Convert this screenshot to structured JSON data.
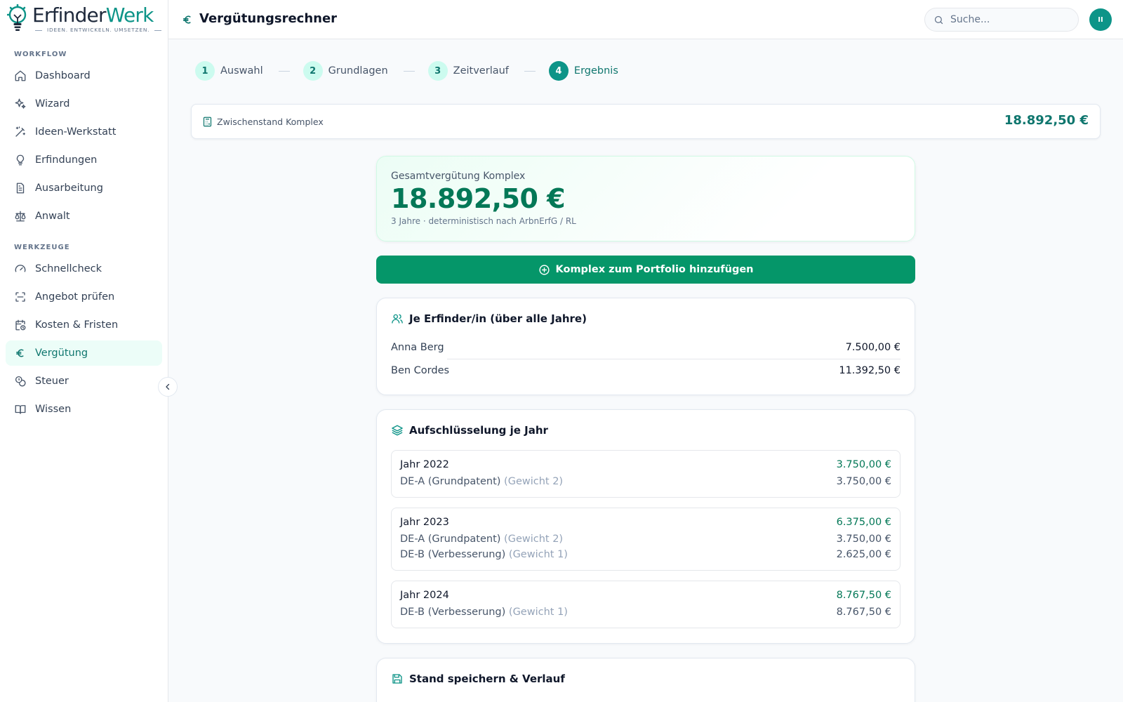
{
  "logo": {
    "word_dark": "Erfinder",
    "word_accent": "Werk",
    "tagline": "IDEEN. ENTWICKELN. UMSETZEN."
  },
  "sidebar": {
    "sections": [
      {
        "label": "WORKFLOW",
        "items": [
          {
            "label": "Dashboard",
            "icon": "home-icon"
          },
          {
            "label": "Wizard",
            "icon": "sparkles-icon"
          },
          {
            "label": "Ideen-Werkstatt",
            "icon": "magic-wand-icon"
          },
          {
            "label": "Erfindungen",
            "icon": "lightbulb-icon"
          },
          {
            "label": "Ausarbeitung",
            "icon": "document-icon"
          },
          {
            "label": "Anwalt",
            "icon": "scales-icon"
          }
        ]
      },
      {
        "label": "WERKZEUGE",
        "items": [
          {
            "label": "Schnellcheck",
            "icon": "gauge-icon"
          },
          {
            "label": "Angebot prüfen",
            "icon": "scan-icon"
          },
          {
            "label": "Kosten & Fristen",
            "icon": "calendar-clock-icon"
          },
          {
            "label": "Vergütung",
            "icon": "euro-icon",
            "active": true
          },
          {
            "label": "Steuer",
            "icon": "coins-icon"
          },
          {
            "label": "Wissen",
            "icon": "book-icon"
          }
        ]
      }
    ]
  },
  "header": {
    "title": "Vergütungsrechner",
    "search_placeholder": "Suche...",
    "avatar_initials": "II"
  },
  "stepper": [
    {
      "num": "1",
      "label": "Auswahl"
    },
    {
      "num": "2",
      "label": "Grundlagen"
    },
    {
      "num": "3",
      "label": "Zeitverlauf"
    },
    {
      "num": "4",
      "label": "Ergebnis",
      "active": true
    }
  ],
  "subtotal": {
    "label": "Zwischenstand Komplex",
    "value": "18.892,50 €"
  },
  "total": {
    "label": "Gesamtvergütung Komplex",
    "value": "18.892,50 €",
    "sub": "3 Jahre · deterministisch nach ArbnErfG / RL"
  },
  "add_button": {
    "label": "Komplex zum Portfolio hinzufügen"
  },
  "inventors": {
    "title": "Je Erfinder/in (über alle Jahre)",
    "rows": [
      {
        "name": "Anna Berg",
        "amount": "7.500,00 €"
      },
      {
        "name": "Ben Cordes",
        "amount": "11.392,50 €"
      }
    ]
  },
  "breakdown": {
    "title": "Aufschlüsselung je Jahr",
    "years": [
      {
        "year": "Jahr 2022",
        "total": "3.750,00 €",
        "items": [
          {
            "name": "DE-A (Grundpatent)",
            "weight": "(Gewicht 2)",
            "amount": "3.750,00 €"
          }
        ]
      },
      {
        "year": "Jahr 2023",
        "total": "6.375,00 €",
        "items": [
          {
            "name": "DE-A (Grundpatent)",
            "weight": "(Gewicht 2)",
            "amount": "3.750,00 €"
          },
          {
            "name": "DE-B (Verbesserung)",
            "weight": "(Gewicht 1)",
            "amount": "2.625,00 €"
          }
        ]
      },
      {
        "year": "Jahr 2024",
        "total": "8.767,50 €",
        "items": [
          {
            "name": "DE-B (Verbesserung)",
            "weight": "(Gewicht 1)",
            "amount": "8.767,50 €"
          }
        ]
      }
    ]
  },
  "save": {
    "title": "Stand speichern & Verlauf"
  },
  "colors": {
    "accent": "#0d9488",
    "accent_dark": "#0f766e",
    "money_green": "#047857",
    "button_green": "#059669"
  }
}
